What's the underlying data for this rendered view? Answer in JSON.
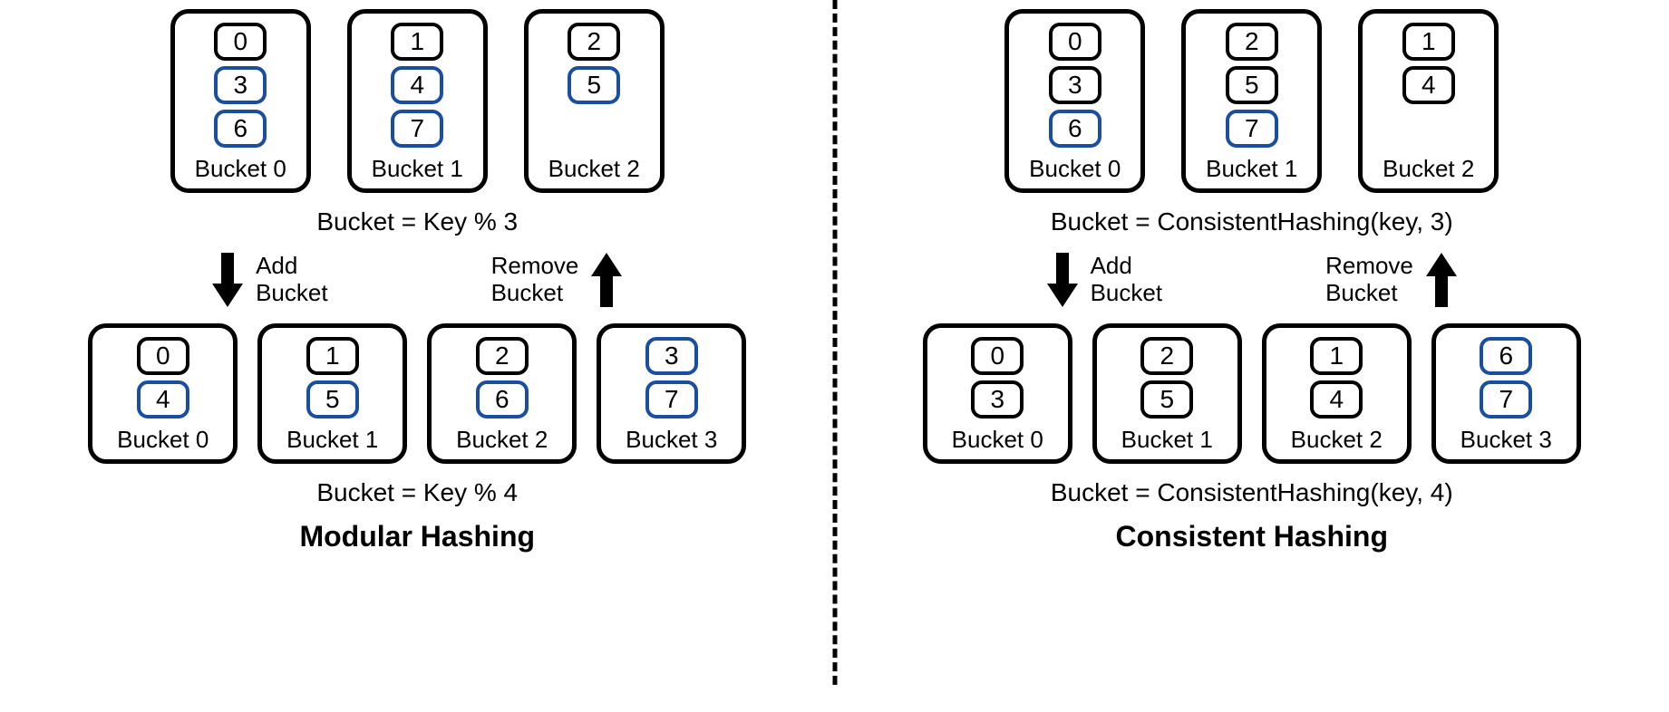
{
  "left": {
    "title": "Modular Hashing",
    "top": {
      "buckets": [
        {
          "label": "Bucket 0",
          "keys": [
            {
              "v": "0",
              "moved": false
            },
            {
              "v": "3",
              "moved": true
            },
            {
              "v": "6",
              "moved": true
            }
          ]
        },
        {
          "label": "Bucket 1",
          "keys": [
            {
              "v": "1",
              "moved": false
            },
            {
              "v": "4",
              "moved": true
            },
            {
              "v": "7",
              "moved": true
            }
          ]
        },
        {
          "label": "Bucket 2",
          "keys": [
            {
              "v": "2",
              "moved": false
            },
            {
              "v": "5",
              "moved": true
            }
          ]
        }
      ],
      "formula": "Bucket = Key % 3"
    },
    "arrows": {
      "add": "Add\nBucket",
      "remove": "Remove\nBucket"
    },
    "bottom": {
      "buckets": [
        {
          "label": "Bucket 0",
          "keys": [
            {
              "v": "0",
              "moved": false
            },
            {
              "v": "4",
              "moved": true
            }
          ]
        },
        {
          "label": "Bucket 1",
          "keys": [
            {
              "v": "1",
              "moved": false
            },
            {
              "v": "5",
              "moved": true
            }
          ]
        },
        {
          "label": "Bucket 2",
          "keys": [
            {
              "v": "2",
              "moved": false
            },
            {
              "v": "6",
              "moved": true
            }
          ]
        },
        {
          "label": "Bucket 3",
          "keys": [
            {
              "v": "3",
              "moved": true
            },
            {
              "v": "7",
              "moved": true
            }
          ]
        }
      ],
      "formula": "Bucket = Key % 4"
    }
  },
  "right": {
    "title": "Consistent Hashing",
    "top": {
      "buckets": [
        {
          "label": "Bucket 0",
          "keys": [
            {
              "v": "0",
              "moved": false
            },
            {
              "v": "3",
              "moved": false
            },
            {
              "v": "6",
              "moved": true
            }
          ]
        },
        {
          "label": "Bucket 1",
          "keys": [
            {
              "v": "2",
              "moved": false
            },
            {
              "v": "5",
              "moved": false
            },
            {
              "v": "7",
              "moved": true
            }
          ]
        },
        {
          "label": "Bucket 2",
          "keys": [
            {
              "v": "1",
              "moved": false
            },
            {
              "v": "4",
              "moved": false
            }
          ]
        }
      ],
      "formula": "Bucket = ConsistentHashing(key, 3)"
    },
    "arrows": {
      "add": "Add\nBucket",
      "remove": "Remove\nBucket"
    },
    "bottom": {
      "buckets": [
        {
          "label": "Bucket 0",
          "keys": [
            {
              "v": "0",
              "moved": false
            },
            {
              "v": "3",
              "moved": false
            }
          ]
        },
        {
          "label": "Bucket 1",
          "keys": [
            {
              "v": "2",
              "moved": false
            },
            {
              "v": "5",
              "moved": false
            }
          ]
        },
        {
          "label": "Bucket 2",
          "keys": [
            {
              "v": "1",
              "moved": false
            },
            {
              "v": "4",
              "moved": false
            }
          ]
        },
        {
          "label": "Bucket 3",
          "keys": [
            {
              "v": "6",
              "moved": true
            },
            {
              "v": "7",
              "moved": true
            }
          ]
        }
      ],
      "formula": "Bucket = ConsistentHashing(key, 4)"
    }
  }
}
